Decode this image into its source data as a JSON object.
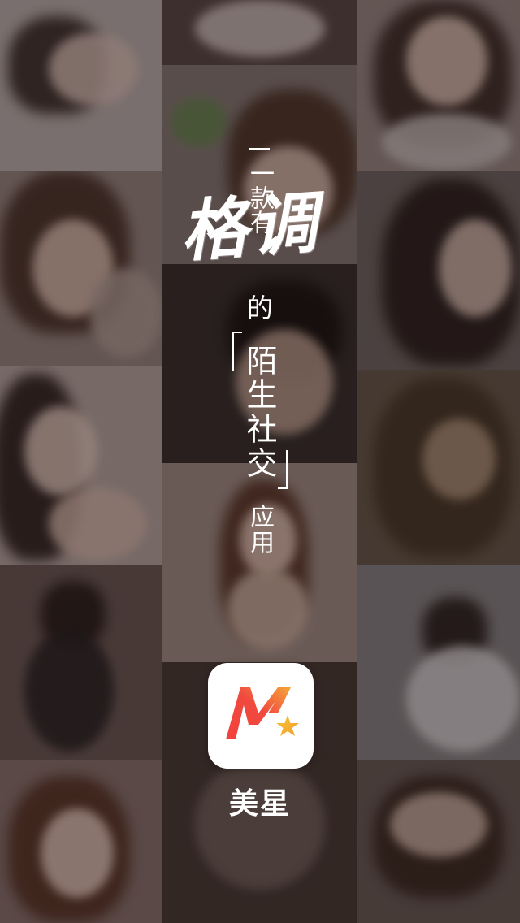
{
  "tagline": {
    "line1": "一款有",
    "highlight": "格调",
    "line2": "的",
    "line3": "陌生社交",
    "line4": "应用"
  },
  "app": {
    "name": "美星",
    "icon": "meixing-logo-icon",
    "icon_colors": {
      "background": "#ffffff",
      "m_gradient_start": "#f2413b",
      "m_gradient_end": "#f7a43a",
      "star": "#f5b62c"
    }
  },
  "background": {
    "type": "blurred-photo-collage",
    "overlay_color": "#0a0606"
  }
}
